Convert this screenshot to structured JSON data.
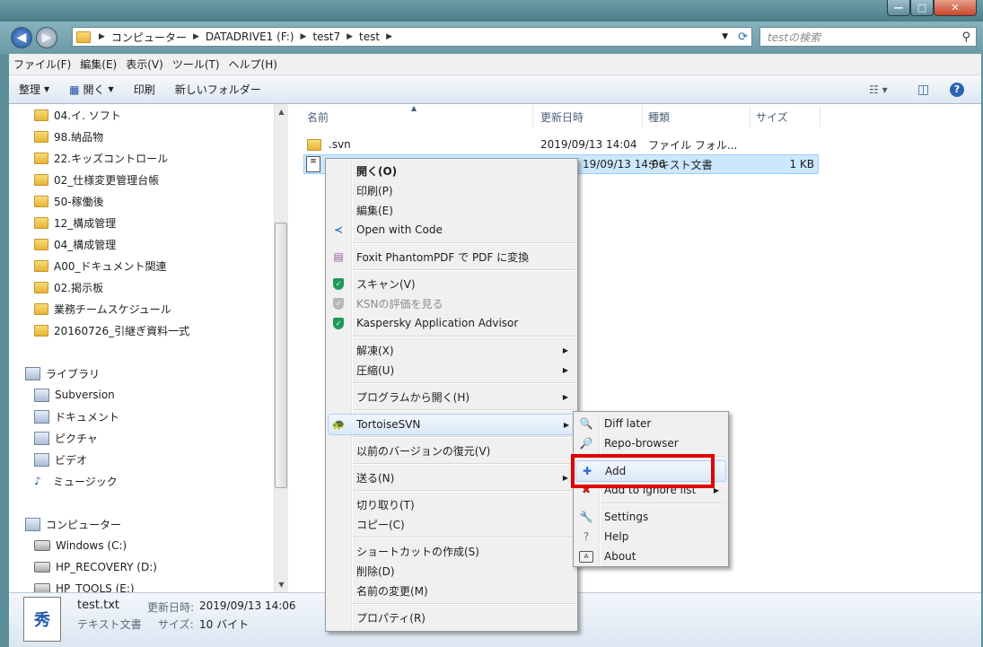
{
  "window": {
    "minimize": "—",
    "maximize": "□",
    "close": "✕"
  },
  "address": {
    "crumbs": [
      "コンピューター",
      "DATADRIVE1 (F:)",
      "test7",
      "test"
    ],
    "search_placeholder": "testの検索"
  },
  "menubar": [
    "ファイル(F)",
    "編集(E)",
    "表示(V)",
    "ツール(T)",
    "ヘルプ(H)"
  ],
  "cmdbar": {
    "organize": "整理",
    "open": "開く",
    "print": "印刷",
    "new_folder": "新しいフォルダー"
  },
  "nav": {
    "folders": [
      "04.イ. ソフト",
      "98.納品物",
      "22.キッズコントロール",
      "02_仕様変更管理台帳",
      "50-稼働後",
      "12_構成管理",
      "04_構成管理",
      "A00_ドキュメント関連",
      "02.掲示板",
      "業務チームスケジュール",
      "20160726_引継ぎ資料一式"
    ],
    "library_title": "ライブラリ",
    "libraries": [
      "Subversion",
      "ドキュメント",
      "ピクチャ",
      "ビデオ",
      "ミュージック"
    ],
    "computer_title": "コンピューター",
    "drives": [
      "Windows  (C:)",
      "HP_RECOVERY (D:)",
      "HP_TOOLS (E:)"
    ]
  },
  "columns": [
    "名前",
    "更新日時",
    "種類",
    "サイズ"
  ],
  "files": [
    {
      "name": ".svn",
      "date": "2019/09/13 14:04",
      "type": "ファイル フォル...",
      "size": ""
    },
    {
      "name": "",
      "date": "19/09/13 14:06",
      "type": "テキスト文書",
      "size": "1 KB"
    }
  ],
  "details": {
    "filename": "test.txt",
    "modified_label": "更新日時:",
    "modified": "2019/09/13 14:06",
    "type": "テキスト文書",
    "size_label": "サイズ:",
    "size": "10 バイト"
  },
  "context_menu": {
    "open": "開く(O)",
    "print": "印刷(P)",
    "edit": "編集(E)",
    "open_with_code": "Open with Code",
    "foxit": "Foxit PhantomPDF で PDF に変換",
    "scan": "スキャン(V)",
    "ksn": "KSNの評価を見る",
    "kaspersky": "Kaspersky Application Advisor",
    "extract": "解凍(X)",
    "compress": "圧縮(U)",
    "open_with": "プログラムから開く(H)",
    "tortoise": "TortoiseSVN",
    "restore": "以前のバージョンの復元(V)",
    "send_to": "送る(N)",
    "cut": "切り取り(T)",
    "copy": "コピー(C)",
    "shortcut": "ショートカットの作成(S)",
    "delete": "削除(D)",
    "rename": "名前の変更(M)",
    "properties": "プロパティ(R)"
  },
  "submenu": {
    "diff_later": "Diff later",
    "repo_browser": "Repo-browser",
    "add": "Add",
    "add_ignore": "Add to ignore list",
    "settings": "Settings",
    "help": "Help",
    "about": "About"
  },
  "colors": {
    "highlight": "#e00000",
    "selection": "#cce8ff"
  }
}
